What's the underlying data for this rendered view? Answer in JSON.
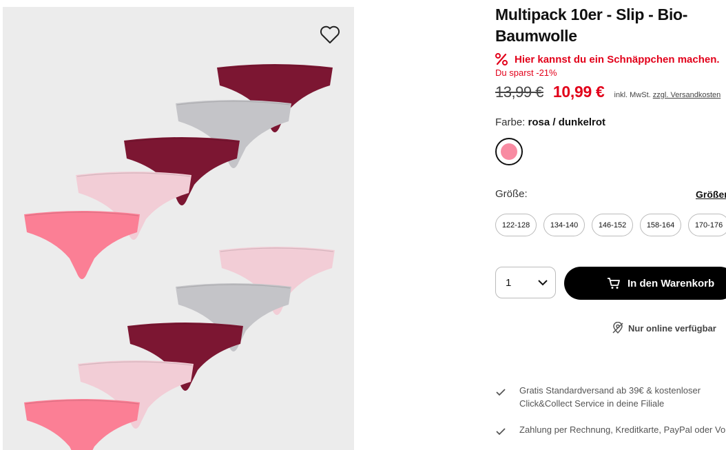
{
  "product": {
    "title": "Multipack 10er - Slip - Bio-Baumwolle",
    "deal_text": "Hier kannst du ein Schnäppchen machen.",
    "savings_text": "Du sparst -21%",
    "old_price": "13,99 €",
    "new_price": "10,99 €",
    "tax_prefix": "inkl. MwSt.",
    "shipping_link": "zzgl. Versandkosten"
  },
  "color": {
    "label": "Farbe:",
    "value": "rosa / dunkelrot",
    "swatch_color": "#f88ba2"
  },
  "size": {
    "label": "Größe:",
    "guide_link": "Größen",
    "options": [
      "122-128",
      "134-140",
      "146-152",
      "158-164",
      "170-176"
    ]
  },
  "purchase": {
    "quantity": "1",
    "add_to_cart": "In den Warenkorb",
    "online_only": "Nur online verfügbar"
  },
  "benefits": [
    {
      "line1": "Gratis Standardversand ab 39€ & kostenloser",
      "line2": "Click&Collect Service in deine Filiale"
    },
    {
      "line1": "Zahlung per Rechnung, Kreditkarte, PayPal oder Vorkasse",
      "line2": ""
    }
  ],
  "colors": {
    "accent": "#e2001a",
    "button": "#000000",
    "gallery_bg": "#ececec"
  }
}
